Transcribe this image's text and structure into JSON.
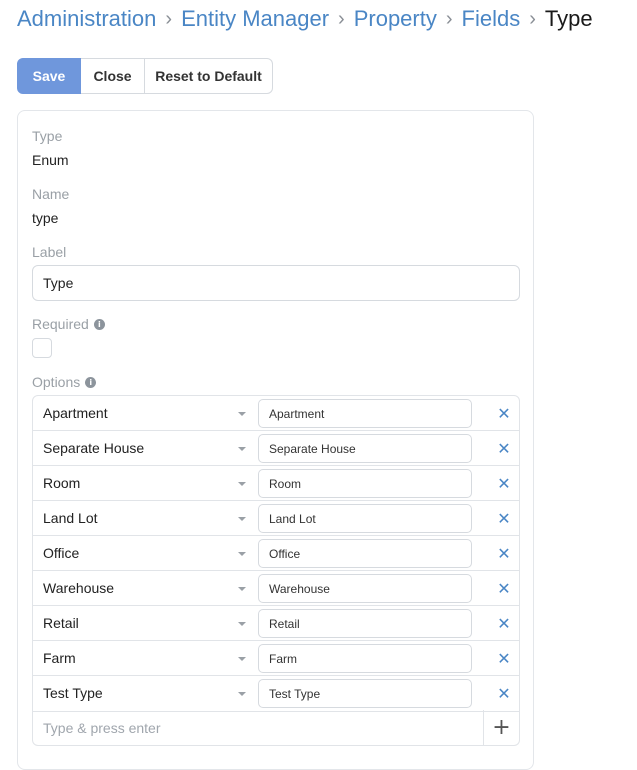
{
  "breadcrumb": {
    "items": [
      "Administration",
      "Entity Manager",
      "Property",
      "Fields"
    ],
    "current": "Type",
    "separator": "›"
  },
  "toolbar": {
    "save_label": "Save",
    "close_label": "Close",
    "reset_label": "Reset to Default"
  },
  "form": {
    "type_label": "Type",
    "type_value": "Enum",
    "name_label": "Name",
    "name_value": "type",
    "label_label": "Label",
    "label_value": "Type",
    "required_label": "Required",
    "options_label": "Options",
    "info_icon": "i",
    "options": [
      {
        "name": "Apartment",
        "label": "Apartment"
      },
      {
        "name": "Separate House",
        "label": "Separate House"
      },
      {
        "name": "Room",
        "label": "Room"
      },
      {
        "name": "Land Lot",
        "label": "Land Lot"
      },
      {
        "name": "Office",
        "label": "Office"
      },
      {
        "name": "Warehouse",
        "label": "Warehouse"
      },
      {
        "name": "Retail",
        "label": "Retail"
      },
      {
        "name": "Farm",
        "label": "Farm"
      },
      {
        "name": "Test Type",
        "label": "Test Type"
      }
    ],
    "remove_icon": "✕",
    "add_placeholder": "Type & press enter",
    "add_icon": "+"
  },
  "colors": {
    "accent": "#6f97dc",
    "link": "#4a86c5"
  }
}
